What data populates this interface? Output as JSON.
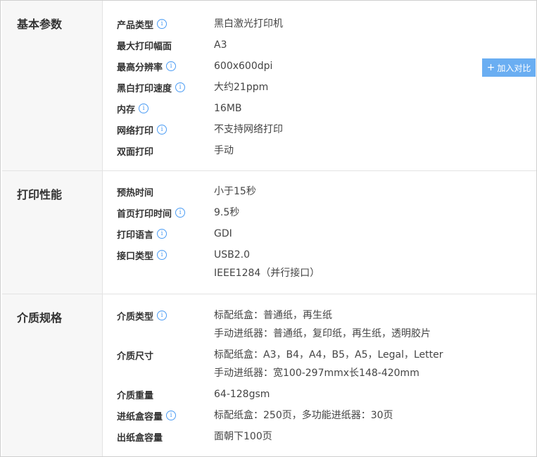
{
  "compare_button": {
    "plus": "+",
    "label": "加入对比"
  },
  "info_icon_glyph": "i",
  "sections": [
    {
      "title": "基本参数",
      "rows": [
        {
          "label": "产品类型",
          "info": true,
          "values": [
            "黑白激光打印机"
          ]
        },
        {
          "label": "最大打印幅面",
          "info": false,
          "values": [
            "A3"
          ]
        },
        {
          "label": "最高分辨率",
          "info": true,
          "values": [
            "600x600dpi"
          ]
        },
        {
          "label": "黑白打印速度",
          "info": true,
          "values": [
            "大约21ppm"
          ]
        },
        {
          "label": "内存",
          "info": true,
          "values": [
            "16MB"
          ]
        },
        {
          "label": "网络打印",
          "info": true,
          "values": [
            "不支持网络打印"
          ]
        },
        {
          "label": "双面打印",
          "info": false,
          "values": [
            "手动"
          ]
        }
      ]
    },
    {
      "title": "打印性能",
      "rows": [
        {
          "label": "预热时间",
          "info": false,
          "values": [
            "小于15秒"
          ]
        },
        {
          "label": "首页打印时间",
          "info": true,
          "values": [
            "9.5秒"
          ]
        },
        {
          "label": "打印语言",
          "info": true,
          "values": [
            "GDI"
          ]
        },
        {
          "label": "接口类型",
          "info": true,
          "values": [
            "USB2.0",
            "IEEE1284（并行接口）"
          ]
        }
      ]
    },
    {
      "title": "介质规格",
      "rows": [
        {
          "label": "介质类型",
          "info": true,
          "values": [
            "标配纸盒：普通纸，再生纸",
            "手动进纸器：普通纸，复印纸，再生纸，透明胶片"
          ]
        },
        {
          "label": "介质尺寸",
          "info": false,
          "values": [
            "标配纸盒：A3，B4，A4，B5，A5，Legal，Letter",
            "手动进纸器：宽100-297mmx长148-420mm"
          ]
        },
        {
          "label": "介质重量",
          "info": false,
          "values": [
            "64-128gsm"
          ]
        },
        {
          "label": "进纸盒容量",
          "info": true,
          "values": [
            "标配纸盒：250页，多功能进纸器：30页"
          ]
        },
        {
          "label": "出纸盒容量",
          "info": false,
          "values": [
            "面朝下100页"
          ]
        }
      ]
    }
  ]
}
